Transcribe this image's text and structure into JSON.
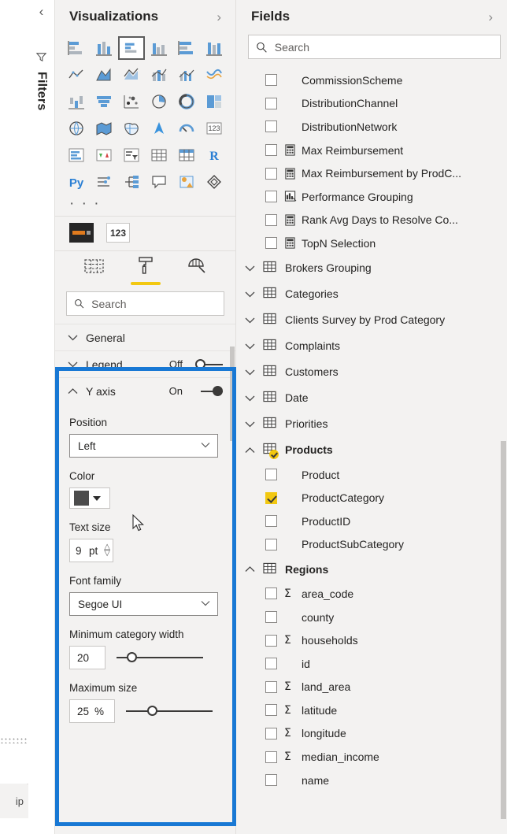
{
  "filters_rail": {
    "collapse_icon": "chevron-left-icon",
    "funnel_icon": "funnel-icon",
    "label": "Filters"
  },
  "page_tabs": {
    "visible_tab_label": "ip",
    "add_page_label": "+"
  },
  "visualizations": {
    "title": "Visualizations",
    "collapse_icon": "chevron-right-icon",
    "icon_grid": [
      {
        "name": "stacked-bar-chart-icon",
        "selected": false
      },
      {
        "name": "stacked-column-chart-icon",
        "selected": false
      },
      {
        "name": "clustered-bar-chart-icon",
        "selected": true
      },
      {
        "name": "clustered-column-chart-icon",
        "selected": false
      },
      {
        "name": "hundred-percent-stacked-bar-chart-icon",
        "selected": false
      },
      {
        "name": "hundred-percent-stacked-column-chart-icon",
        "selected": false
      },
      {
        "name": "line-chart-icon",
        "selected": false
      },
      {
        "name": "area-chart-icon",
        "selected": false
      },
      {
        "name": "stacked-area-chart-icon",
        "selected": false
      },
      {
        "name": "line-and-stacked-column-chart-icon",
        "selected": false
      },
      {
        "name": "line-and-clustered-column-chart-icon",
        "selected": false
      },
      {
        "name": "ribbon-chart-icon",
        "selected": false
      },
      {
        "name": "waterfall-chart-icon",
        "selected": false
      },
      {
        "name": "funnel-chart-icon",
        "selected": false
      },
      {
        "name": "scatter-chart-icon",
        "selected": false
      },
      {
        "name": "pie-chart-icon",
        "selected": false
      },
      {
        "name": "donut-chart-icon",
        "selected": false
      },
      {
        "name": "treemap-icon",
        "selected": false
      },
      {
        "name": "map-icon",
        "selected": false
      },
      {
        "name": "filled-map-icon",
        "selected": false
      },
      {
        "name": "shape-map-icon",
        "selected": false
      },
      {
        "name": "azure-map-icon",
        "selected": false
      },
      {
        "name": "gauge-chart-icon",
        "selected": false
      },
      {
        "name": "card-icon",
        "selected": false
      },
      {
        "name": "multi-row-card-icon",
        "selected": false
      },
      {
        "name": "kpi-icon",
        "selected": false
      },
      {
        "name": "slicer-icon",
        "selected": false
      },
      {
        "name": "table-icon",
        "selected": false
      },
      {
        "name": "matrix-icon",
        "selected": false
      },
      {
        "name": "r-script-visual-icon",
        "selected": false
      },
      {
        "name": "python-visual-icon",
        "selected": false
      },
      {
        "name": "key-influencers-icon",
        "selected": false
      },
      {
        "name": "decomposition-tree-icon",
        "selected": false
      },
      {
        "name": "qna-visual-icon",
        "selected": false
      },
      {
        "name": "smart-narrative-icon",
        "selected": false
      },
      {
        "name": "paginated-report-icon",
        "selected": false
      }
    ],
    "more_label": "· · ·",
    "custom_visuals": [
      {
        "name": "custom-visual-thumbnail"
      },
      {
        "name": "numeric-range-visual-thumbnail",
        "label": "123"
      }
    ],
    "pane_tabs": [
      {
        "name": "build-visual-tab",
        "icon": "fields-grid-icon",
        "active": false
      },
      {
        "name": "format-visual-tab",
        "icon": "paint-roller-icon",
        "active": true
      },
      {
        "name": "analytics-tab",
        "icon": "magnifier-chart-icon",
        "active": false
      }
    ],
    "search": {
      "placeholder": "Search",
      "value": ""
    },
    "sections": [
      {
        "name": "General",
        "expanded": false,
        "has_toggle": false
      },
      {
        "name": "Legend",
        "expanded": false,
        "has_toggle": true,
        "toggle_label": "Off",
        "toggle_on": false
      },
      {
        "name": "Y axis",
        "expanded": true,
        "has_toggle": true,
        "toggle_label": "On",
        "toggle_on": true
      }
    ],
    "y_axis": {
      "position": {
        "label": "Position",
        "value": "Left"
      },
      "color": {
        "label": "Color",
        "value": "#4c4c4c"
      },
      "text_size": {
        "label": "Text size",
        "value": "9",
        "unit": "pt"
      },
      "font_family": {
        "label": "Font family",
        "value": "Segoe UI"
      },
      "minimum_category_width": {
        "label": "Minimum category width",
        "value": "20",
        "slider_percent": 12
      },
      "maximum_size": {
        "label": "Maximum size",
        "value": "25",
        "unit": "%",
        "slider_percent": 25
      }
    }
  },
  "fields": {
    "title": "Fields",
    "collapse_icon": "chevron-right-icon",
    "search": {
      "placeholder": "Search",
      "value": ""
    },
    "loose_fields": [
      {
        "label": "CommissionScheme",
        "checked": false,
        "icon": "none"
      },
      {
        "label": "DistributionChannel",
        "checked": false,
        "icon": "none"
      },
      {
        "label": "DistributionNetwork",
        "checked": false,
        "icon": "none"
      },
      {
        "label": "Max Reimbursement",
        "checked": false,
        "icon": "measure-icon"
      },
      {
        "label": "Max Reimbursement by ProdC...",
        "checked": false,
        "icon": "measure-icon"
      },
      {
        "label": "Performance Grouping",
        "checked": false,
        "icon": "group-measure-icon"
      },
      {
        "label": "Rank Avg Days to Resolve Co...",
        "checked": false,
        "icon": "measure-icon"
      },
      {
        "label": "TopN Selection",
        "checked": false,
        "icon": "measure-icon"
      }
    ],
    "tables": [
      {
        "label": "Brokers Grouping",
        "expanded": false,
        "badge": false,
        "children": []
      },
      {
        "label": "Categories",
        "expanded": false,
        "badge": false,
        "children": []
      },
      {
        "label": "Clients Survey by Prod Category",
        "expanded": false,
        "badge": false,
        "children": []
      },
      {
        "label": "Complaints",
        "expanded": false,
        "badge": false,
        "children": []
      },
      {
        "label": "Customers",
        "expanded": false,
        "badge": false,
        "children": []
      },
      {
        "label": "Date",
        "expanded": false,
        "badge": false,
        "children": []
      },
      {
        "label": "Priorities",
        "expanded": false,
        "badge": false,
        "children": []
      },
      {
        "label": "Products",
        "expanded": true,
        "badge": true,
        "children": [
          {
            "label": "Product",
            "checked": false,
            "icon": "none"
          },
          {
            "label": "ProductCategory",
            "checked": true,
            "icon": "none"
          },
          {
            "label": "ProductID",
            "checked": false,
            "icon": "none"
          },
          {
            "label": "ProductSubCategory",
            "checked": false,
            "icon": "none"
          }
        ]
      },
      {
        "label": "Regions",
        "expanded": true,
        "badge": false,
        "children": [
          {
            "label": "area_code",
            "checked": false,
            "icon": "sigma-icon"
          },
          {
            "label": "county",
            "checked": false,
            "icon": "none"
          },
          {
            "label": "households",
            "checked": false,
            "icon": "sigma-icon"
          },
          {
            "label": "id",
            "checked": false,
            "icon": "none"
          },
          {
            "label": "land_area",
            "checked": false,
            "icon": "sigma-icon"
          },
          {
            "label": "latitude",
            "checked": false,
            "icon": "sigma-icon"
          },
          {
            "label": "longitude",
            "checked": false,
            "icon": "sigma-icon"
          },
          {
            "label": "median_income",
            "checked": false,
            "icon": "sigma-icon"
          },
          {
            "label": "name",
            "checked": false,
            "icon": "none"
          }
        ]
      }
    ]
  },
  "annotation": {
    "highlight_color": "#1878d4"
  }
}
